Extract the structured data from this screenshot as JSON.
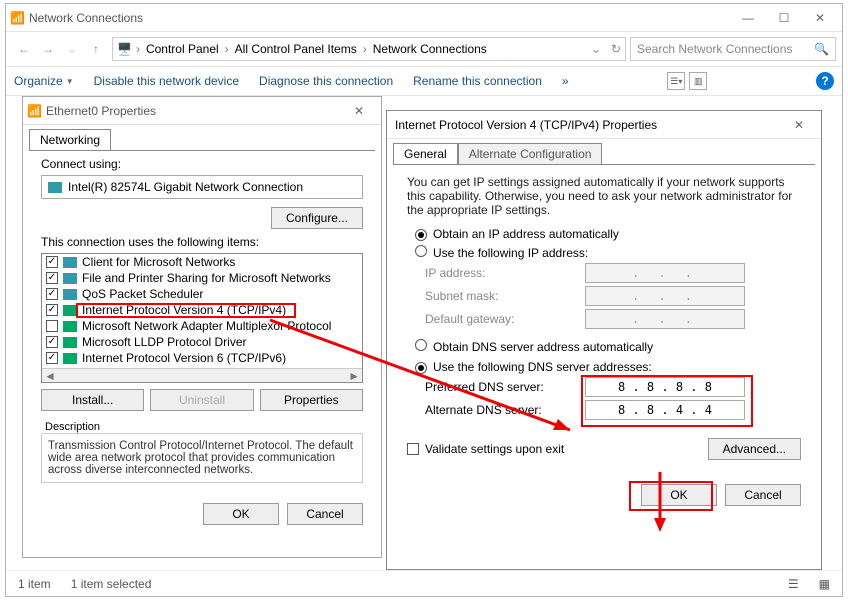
{
  "explorer": {
    "title": "Network Connections",
    "breadcrumb": [
      "Control Panel",
      "All Control Panel Items",
      "Network Connections"
    ],
    "search_placeholder": "Search Network Connections",
    "commands": {
      "organize": "Organize",
      "disable": "Disable this network device",
      "diagnose": "Diagnose this connection",
      "rename": "Rename this connection",
      "more": "»"
    },
    "status_left": "1 item",
    "status_sel": "1 item selected"
  },
  "eprops": {
    "title": "Ethernet0 Properties",
    "tab": "Networking",
    "connect_label": "Connect using:",
    "adapter": "Intel(R) 82574L Gigabit Network Connection",
    "configure": "Configure...",
    "items_label": "This connection uses the following items:",
    "items": [
      {
        "checked": true,
        "icon": "net",
        "label": "Client for Microsoft Networks"
      },
      {
        "checked": true,
        "icon": "net",
        "label": "File and Printer Sharing for Microsoft Networks"
      },
      {
        "checked": true,
        "icon": "net",
        "label": "QoS Packet Scheduler"
      },
      {
        "checked": true,
        "icon": "proto",
        "label": "Internet Protocol Version 4 (TCP/IPv4)"
      },
      {
        "checked": false,
        "icon": "proto",
        "label": "Microsoft Network Adapter Multiplexor Protocol"
      },
      {
        "checked": true,
        "icon": "proto",
        "label": "Microsoft LLDP Protocol Driver"
      },
      {
        "checked": true,
        "icon": "proto",
        "label": "Internet Protocol Version 6 (TCP/IPv6)"
      }
    ],
    "install": "Install...",
    "uninstall": "Uninstall",
    "properties": "Properties",
    "desc_title": "Description",
    "desc": "Transmission Control Protocol/Internet Protocol. The default wide area network protocol that provides communication across diverse interconnected networks.",
    "ok": "OK",
    "cancel": "Cancel"
  },
  "tprops": {
    "title": "Internet Protocol Version 4 (TCP/IPv4) Properties",
    "tab_general": "General",
    "tab_alt": "Alternate Configuration",
    "blurb": "You can get IP settings assigned automatically if your network supports this capability. Otherwise, you need to ask your network administrator for the appropriate IP settings.",
    "obtain_ip": "Obtain an IP address automatically",
    "use_ip": "Use the following IP address:",
    "ip_addr": "IP address:",
    "subnet": "Subnet mask:",
    "gateway": "Default gateway:",
    "obtain_dns": "Obtain DNS server address automatically",
    "use_dns": "Use the following DNS server addresses:",
    "pref_dns": "Preferred DNS server:",
    "alt_dns": "Alternate DNS server:",
    "dns1": "8 . 8 . 8 . 8",
    "dns2": "8 . 8 . 4 . 4",
    "validate": "Validate settings upon exit",
    "advanced": "Advanced...",
    "ok": "OK",
    "cancel": "Cancel"
  }
}
